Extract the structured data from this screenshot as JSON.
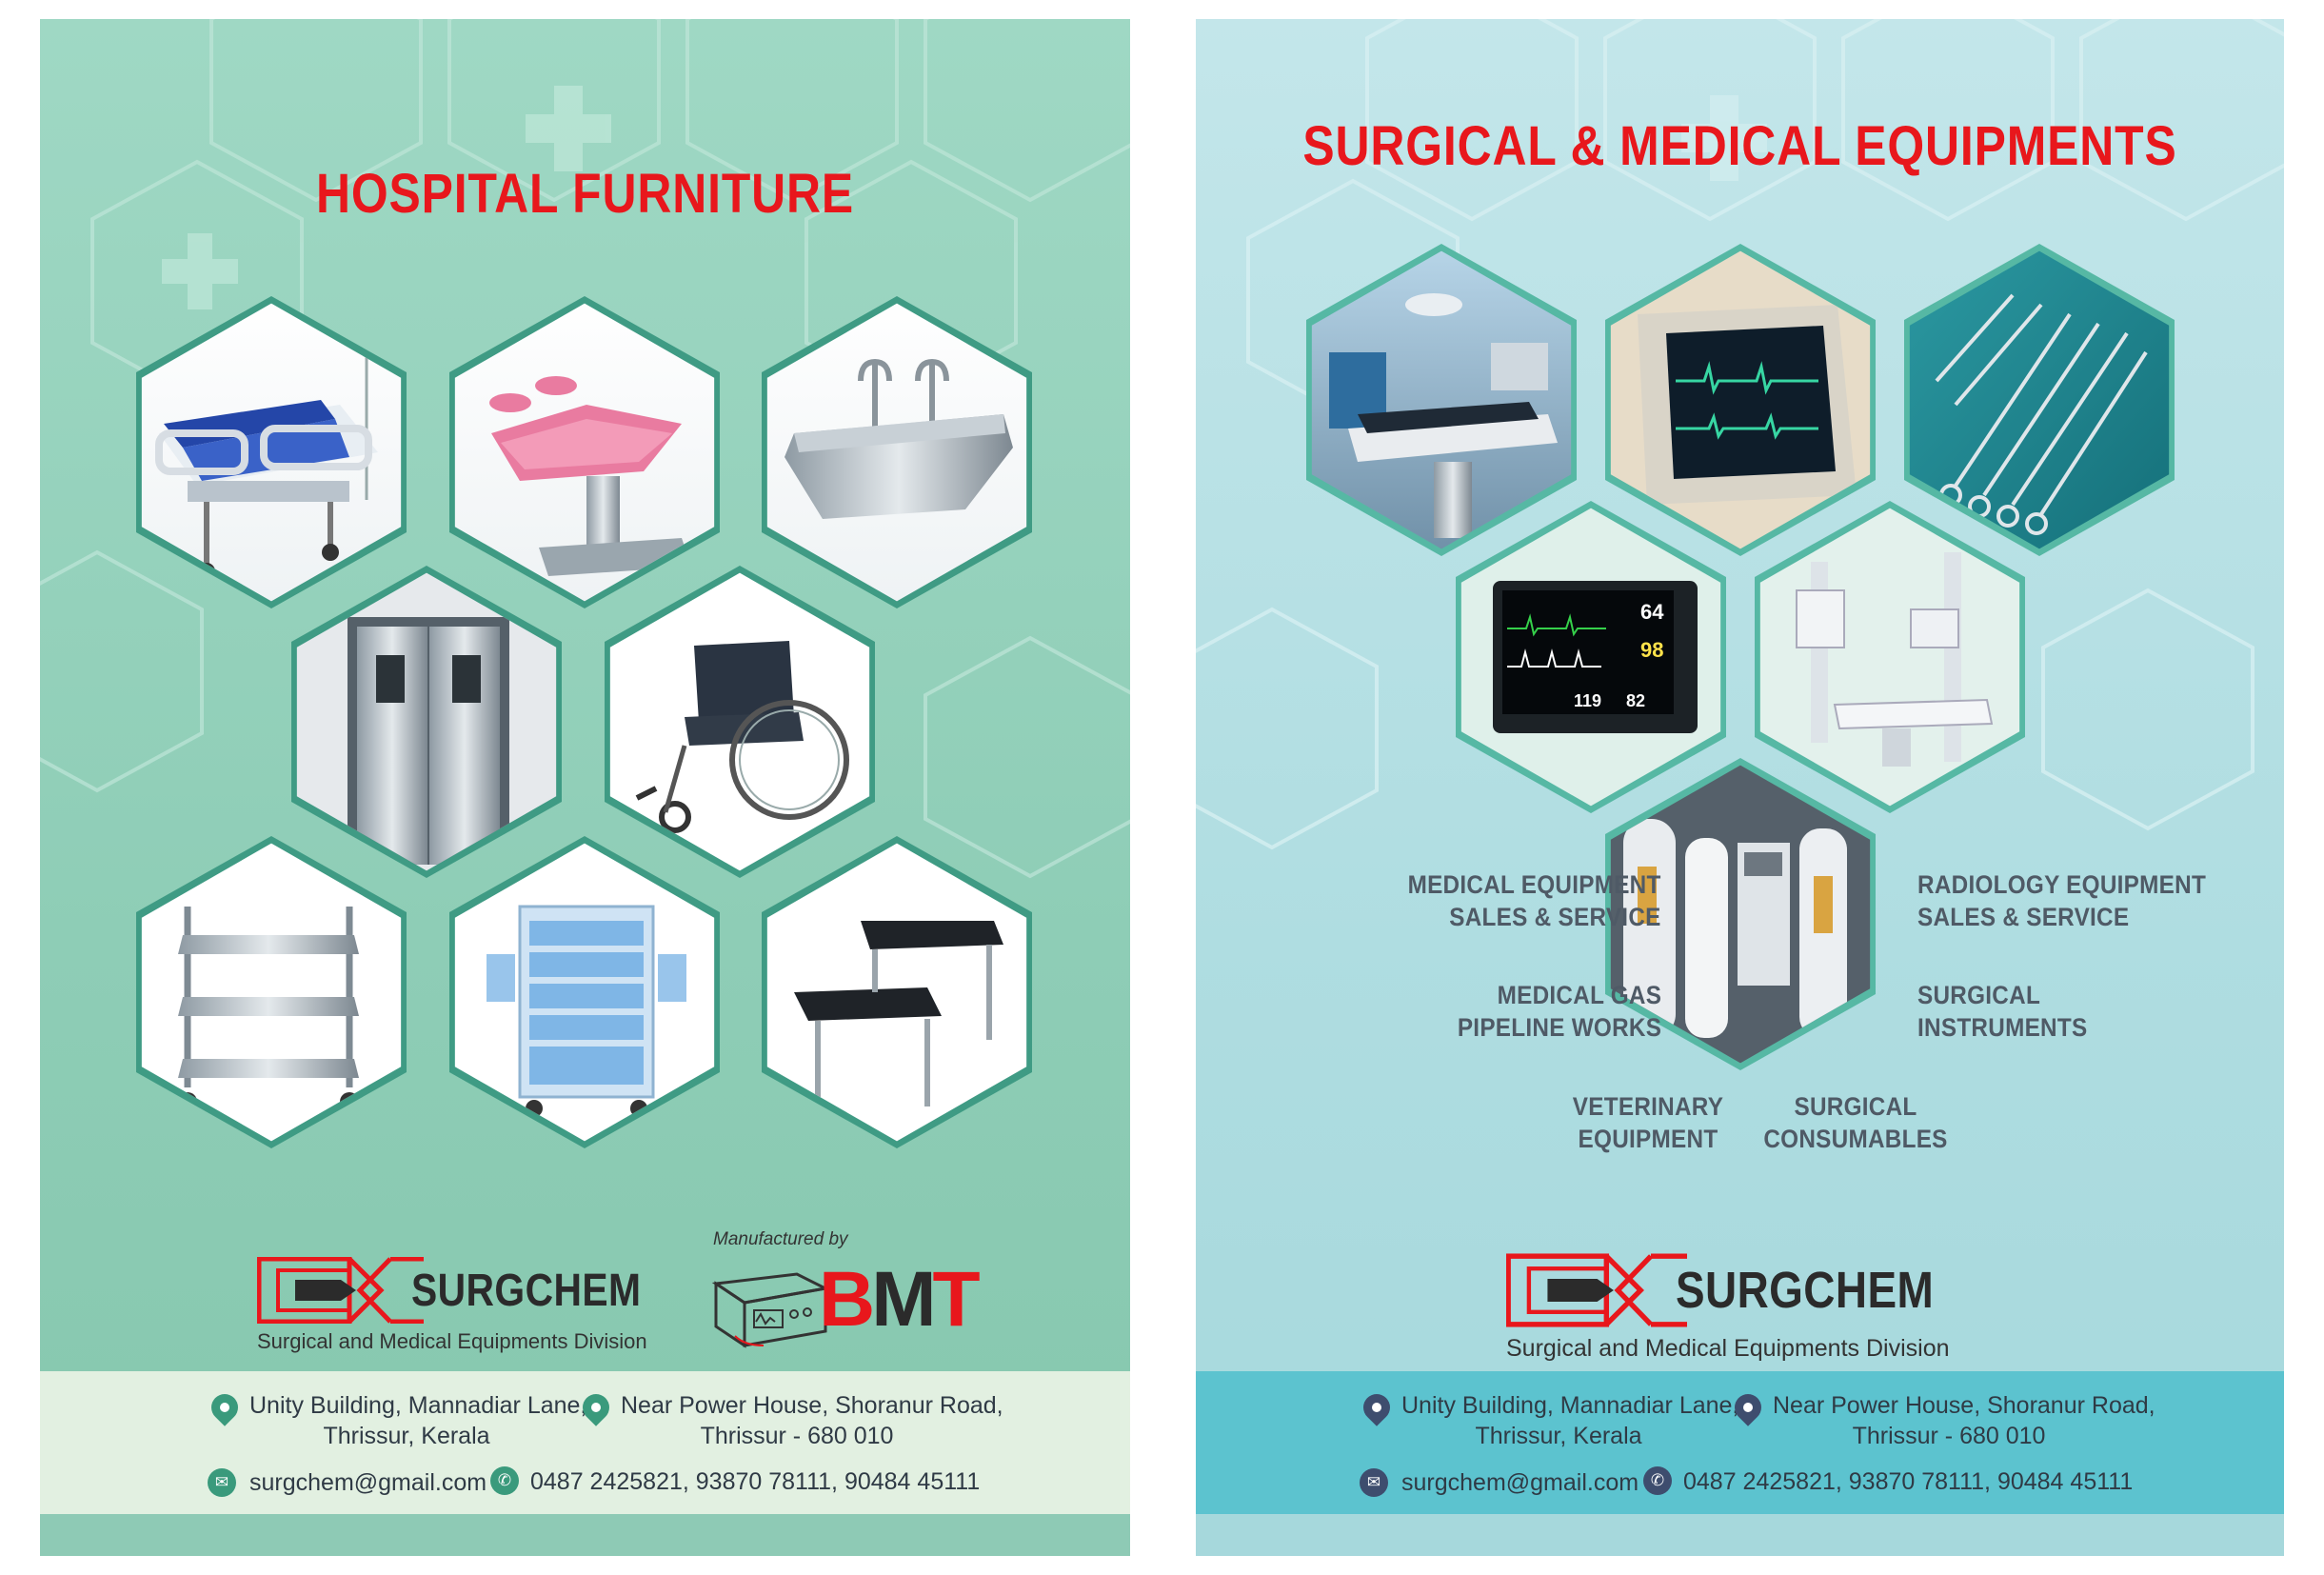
{
  "left": {
    "title": "HOSPITAL FURNITURE",
    "products": [
      {
        "name": "ICU bed"
      },
      {
        "name": "Delivery / gynaecology table"
      },
      {
        "name": "Scrub sink"
      },
      {
        "name": "Hospital doors"
      },
      {
        "name": "Wheelchair"
      },
      {
        "name": "Instrument trolley"
      },
      {
        "name": "Medicine cart"
      },
      {
        "name": "Foot step"
      }
    ],
    "logo_name": "SURGCHEM",
    "logo_tagline": "Surgical and Medical Equipments Division",
    "manufactured_by": "Manufactured by",
    "bmt": "BMT",
    "footer": {
      "address1_line1": "Unity Building, Mannadiar Lane,",
      "address1_line2": "Thrissur, Kerala",
      "address2_line1": "Near Power House, Shoranur Road,",
      "address2_line2": "Thrissur - 680 010",
      "email": "surgchem@gmail.com",
      "phone": "0487 2425821, 93870 78111, 90484 45111"
    }
  },
  "right": {
    "title": "SURGICAL & MEDICAL EQUIPMENTS",
    "products": [
      {
        "name": "Operation theatre"
      },
      {
        "name": "Monitor"
      },
      {
        "name": "Surgical instruments"
      },
      {
        "name": "Patient monitor"
      },
      {
        "name": "X-ray system"
      },
      {
        "name": "Oxygen plant"
      }
    ],
    "monitor_readings": [
      "64",
      "98",
      "119",
      "82"
    ],
    "services": {
      "medical_equipment": [
        "MEDICAL EQUIPMENT",
        "SALES & SERVICE"
      ],
      "radiology_equipment": [
        "RADIOLOGY EQUIPMENT",
        "SALES & SERVICE"
      ],
      "medical_gas": [
        "MEDICAL GAS",
        "PIPELINE WORKS"
      ],
      "surgical_instruments": [
        "SURGICAL",
        "INSTRUMENTS"
      ],
      "veterinary": [
        "VETERINARY",
        "EQUIPMENT"
      ],
      "surgical_consumables": [
        "SURGICAL",
        "CONSUMABLES"
      ]
    },
    "logo_name": "SURGCHEM",
    "logo_tagline": "Surgical and Medical Equipments Division",
    "footer": {
      "address1_line1": "Unity Building, Mannadiar Lane,",
      "address1_line2": "Thrissur, Kerala",
      "address2_line1": "Near Power House, Shoranur Road,",
      "address2_line2": "Thrissur - 680 010",
      "email": "surgchem@gmail.com",
      "phone": "0487 2425821, 93870 78111, 90484 45111"
    }
  },
  "colors": {
    "title_red": "#e8171c",
    "left_bg": "#9fd8c4",
    "right_bg": "#b9e2e6",
    "left_footer": "#e2f0e1",
    "right_footer": "#5cc3cf",
    "hex_border_left": "#3f9b84",
    "hex_border_right": "#56b8a4"
  },
  "icons": [
    "location-pin-icon",
    "email-icon",
    "phone-icon"
  ]
}
